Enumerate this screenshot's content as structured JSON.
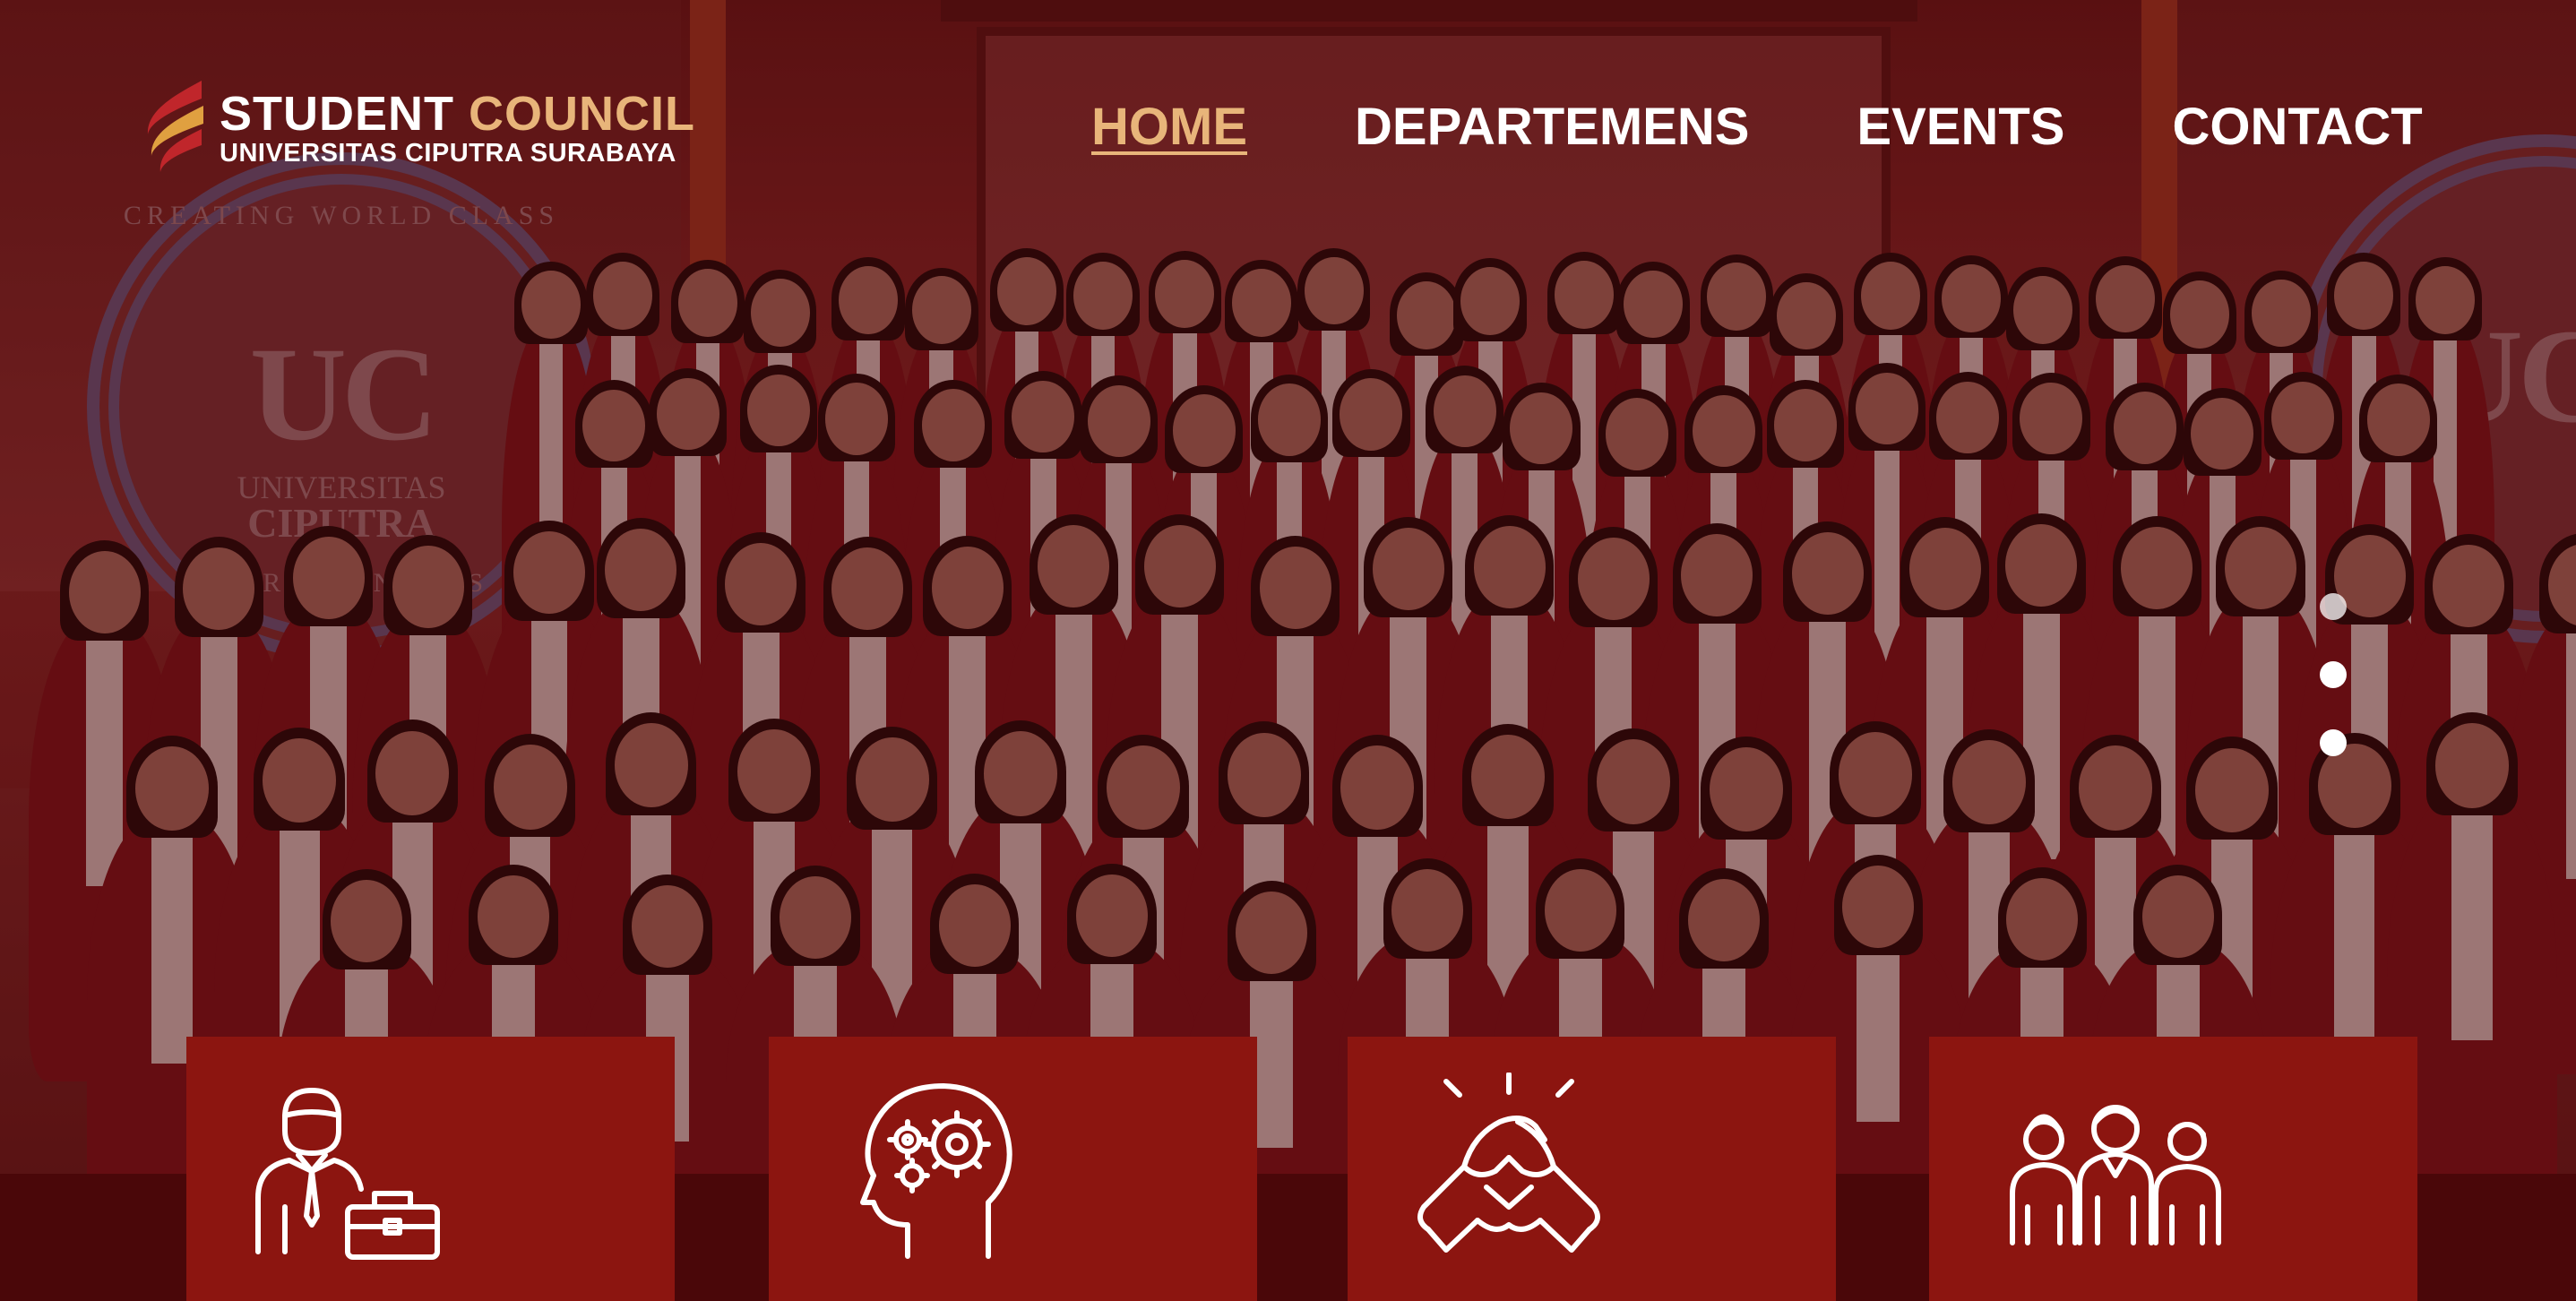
{
  "brand": {
    "title_main": "STUDENT",
    "title_accent": "COUNCIL",
    "subtitle": "UNIVERSITAS CIPUTRA SURABAYA"
  },
  "nav": {
    "items": [
      {
        "label": "HOME",
        "active": true
      },
      {
        "label": "DEPARTEMENS",
        "active": false
      },
      {
        "label": "EVENTS",
        "active": false
      },
      {
        "label": "CONTACT",
        "active": false
      }
    ]
  },
  "hero": {
    "seal_letters": "UC",
    "seal_name_line1": "UNIVERSITAS",
    "seal_name_line2": "CIPUTRA",
    "seal_arc_text": "CREATING WORLD CLASS",
    "seal_arc_bottom": "ENTREPRENEURS"
  },
  "slider": {
    "dots": 3,
    "active_index": 1
  },
  "cards": [
    {
      "icon": "businessman-briefcase-icon"
    },
    {
      "icon": "head-gears-icon"
    },
    {
      "icon": "handshake-icon"
    },
    {
      "icon": "team-group-icon"
    }
  ],
  "colors": {
    "accent": "#e8b57a",
    "card": "#8c1510",
    "strip": "#4a0709",
    "text": "#ffffff"
  }
}
